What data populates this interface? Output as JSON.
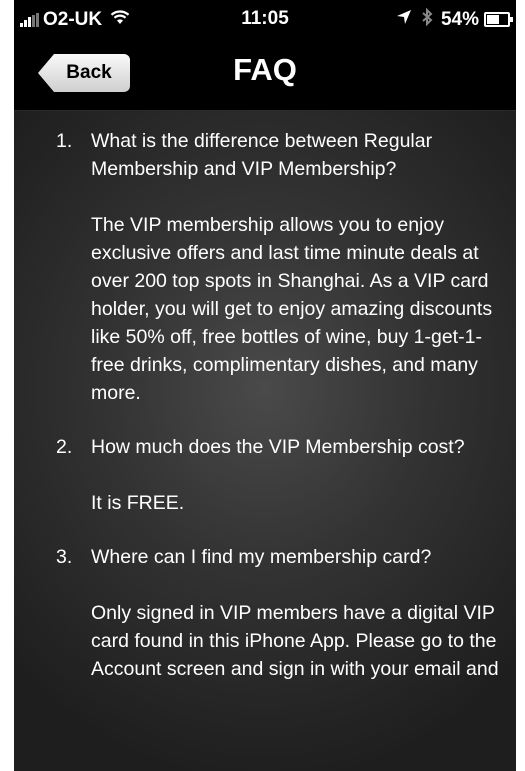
{
  "status_bar": {
    "carrier": "O2-UK",
    "time": "11:05",
    "battery": "54%",
    "battery_level": 0.54,
    "icons": [
      "signal-icon",
      "wifi-icon",
      "location-arrow-icon",
      "bluetooth-icon",
      "battery-icon"
    ]
  },
  "nav": {
    "back_label": "Back",
    "title": "FAQ"
  },
  "faq": [
    {
      "number": "1.",
      "question": "What is the difference between Regular Membership and VIP Membership?",
      "answer": "The VIP membership allows you to enjoy exclusive offers and last time minute deals at over 200 top spots in Shanghai. As a VIP card holder, you will get to enjoy amazing discounts like 50% off, free bottles of wine, buy 1-get-1-free drinks, complimentary dishes, and many more."
    },
    {
      "number": "2.",
      "question": "How much does the VIP Membership cost?",
      "answer": "It is FREE."
    },
    {
      "number": "3.",
      "question": "Where can I find my membership card?",
      "answer": "Only signed in VIP members have a digital VIP card found in this iPhone App.  Please go to the Account screen and sign in with your email and"
    }
  ]
}
